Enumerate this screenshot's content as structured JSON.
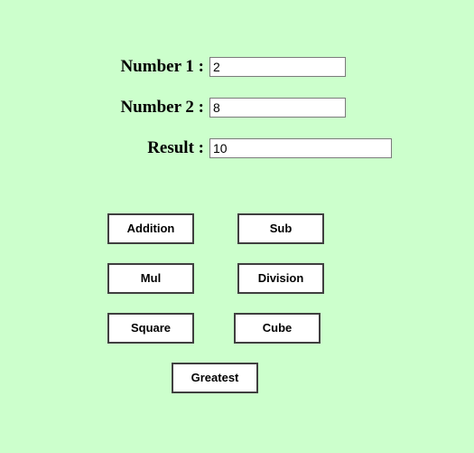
{
  "page": {
    "background_color": "#ccffcc",
    "text_color": "#000000",
    "button_border_color": "#404040",
    "input_border_color": "#7b7b7b",
    "input_background_color": "#ffffff"
  },
  "form": {
    "fields": [
      {
        "label": "Number 1 :",
        "value": "2",
        "placeholder": ""
      },
      {
        "label": "Number 2 :",
        "value": "8",
        "placeholder": ""
      },
      {
        "label": "Result :",
        "value": "10",
        "placeholder": ""
      }
    ]
  },
  "buttons": [
    {
      "label": "Addition"
    },
    {
      "label": "Sub"
    },
    {
      "label": "Mul"
    },
    {
      "label": "Division"
    },
    {
      "label": "Square"
    },
    {
      "label": "Cube"
    },
    {
      "label": "Greatest"
    }
  ]
}
